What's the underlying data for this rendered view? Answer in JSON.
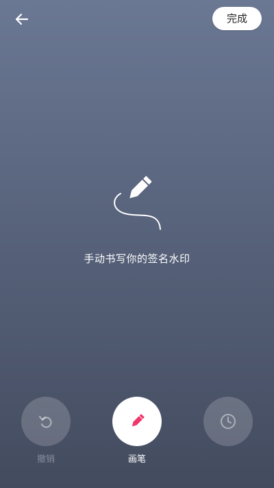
{
  "header": {
    "back_icon": "arrow-left-icon",
    "done_label": "完成"
  },
  "hint": {
    "illustration_icon": "pen-signature-icon",
    "text": "手动书写你的签名水印"
  },
  "toolbar": {
    "undo": {
      "label": "撤销",
      "icon": "undo-icon",
      "enabled": false
    },
    "pen": {
      "label": "画笔",
      "icon": "pencil-icon",
      "active": true,
      "color": "#f0356b"
    },
    "history": {
      "label": "",
      "icon": "clock-icon",
      "enabled": false
    }
  },
  "colors": {
    "bg_top": "#6b7893",
    "bg_bottom": "#434b5e",
    "accent": "#f0356b"
  }
}
